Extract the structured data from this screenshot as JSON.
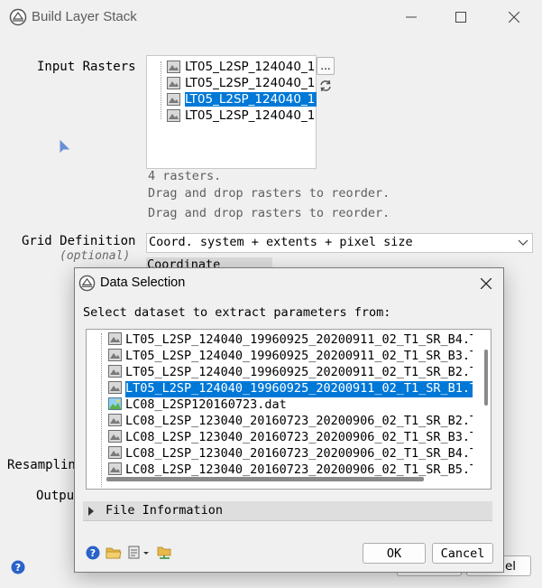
{
  "main": {
    "title": "Build Layer Stack",
    "input_rasters_label": "Input Rasters",
    "rasters": [
      {
        "name": "LT05_L2SP_124040_1"
      },
      {
        "name": "LT05_L2SP_124040_1"
      },
      {
        "name": "LT05_L2SP_124040_1",
        "selected": true
      },
      {
        "name": "LT05_L2SP_124040_1"
      }
    ],
    "browse_label": "...",
    "raster_count_text": "4 rasters.",
    "reorder_hint_1": "Drag and drop rasters to reorder.",
    "reorder_hint_2": "Drag and drop rasters to reorder.",
    "grid_definition_label": "Grid Definition",
    "optional_label": "(optional)",
    "grid_definition_value": "Coord. system + extents + pixel size",
    "coordinate_system_label": "Coordinate System",
    "resampling_label_partial": "Resamplin",
    "output_label_partial": "Outpu",
    "cancel_label_partial": "el"
  },
  "dialog": {
    "title": "Data Selection",
    "prompt": "Select dataset to extract parameters from:",
    "datasets": [
      {
        "name": "LT05_L2SP_124040_19960925_20200911_02_T1_SR_B4.T",
        "icon": "raster-icon"
      },
      {
        "name": "LT05_L2SP_124040_19960925_20200911_02_T1_SR_B3.T",
        "icon": "raster-icon"
      },
      {
        "name": "LT05_L2SP_124040_19960925_20200911_02_T1_SR_B2.T",
        "icon": "raster-icon"
      },
      {
        "name": "LT05_L2SP_124040_19960925_20200911_02_T1_SR_B1.T",
        "icon": "raster-icon",
        "selected": true
      },
      {
        "name": "LC08_L2SP120160723.dat",
        "icon": "color-raster-icon"
      },
      {
        "name": "LC08_L2SP_123040_20160723_20200906_02_T1_SR_B2.T",
        "icon": "raster-icon"
      },
      {
        "name": "LC08_L2SP_123040_20160723_20200906_02_T1_SR_B3.T",
        "icon": "raster-icon"
      },
      {
        "name": "LC08_L2SP_123040_20160723_20200906_02_T1_SR_B4.T",
        "icon": "raster-icon"
      },
      {
        "name": "LC08_L2SP_123040_20160723_20200906_02_T1_SR_B5.T",
        "icon": "raster-icon"
      }
    ],
    "file_information_label": "File Information",
    "ok_label": "OK",
    "cancel_label": "Cancel"
  },
  "colors": {
    "selection": "#0078d7",
    "help_blue": "#2a62c9",
    "folder_yellow": "#e8b84a"
  }
}
